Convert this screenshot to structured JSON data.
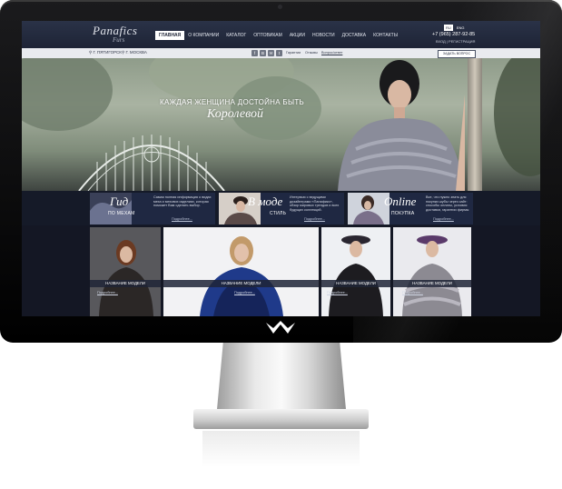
{
  "header": {
    "brand": "Panafics",
    "brand_sub": "Furs",
    "nav": [
      "ГЛАВНАЯ",
      "О КОМПАНИИ",
      "КАТАЛОГ",
      "ОПТОВИКАМ",
      "АКЦИИ",
      "НОВОСТИ",
      "ДОСТАВКА",
      "КОНТАКТЫ"
    ],
    "languages": [
      "RU",
      "ENG"
    ],
    "phone": "+7 (965) 287-92-85",
    "login": "ВХОД | РЕГИСТРАЦИЯ"
  },
  "subbar": {
    "locations": [
      "Г. ПЯТИГОРСК",
      "Г. МОСКВА"
    ],
    "social": [
      "f",
      "В",
      "✉",
      "t"
    ],
    "links": [
      "Гарантии",
      "Отзывы",
      "Вопрос/ответ"
    ],
    "ask_button": "ЗАДАТЬ ВОПРОС"
  },
  "hero": {
    "slogan": "КАЖДАЯ ЖЕНЩИНА ДОСТОЙНА БЫТЬ",
    "slogan_script": "Королевой"
  },
  "promos": [
    {
      "big": "Гид",
      "caption": "ПО МЕХАМ",
      "text": "Самая полная информация о видах меха и мехових изделиях, которая поможет Вам сделать выбор.",
      "more": "Подробнее..."
    },
    {
      "big": "В моде",
      "caption": "СТИЛЬ",
      "text": "Интервью с ведущими дизайнерами «Панафикс», обзор мировых трендов и всех будущих коллекций.",
      "more": "Подробнее..."
    },
    {
      "big": "Online",
      "caption": "ПОКУПКА",
      "text": "Все, что нужно знать для покупки шубы через сайт: способы оплаты, условия доставки, гарантии фирмы",
      "more": "Подробнее..."
    }
  ],
  "gallery": [
    {
      "label": "НАЗВАНИЕ МОДЕЛИ",
      "more": "Подробнее..."
    },
    {
      "label": "НАЗВАНИЕ МОДЕЛИ",
      "more": "Подробнее..."
    },
    {
      "label": "НАЗВАНИЕ МОДЕЛИ",
      "more": "Подробнее..."
    },
    {
      "label": "НАЗВАНИЕ МОДЕЛИ",
      "more": "Подробнее..."
    }
  ],
  "colors": {
    "header": "#1e2436",
    "accent": "#ffffff"
  }
}
